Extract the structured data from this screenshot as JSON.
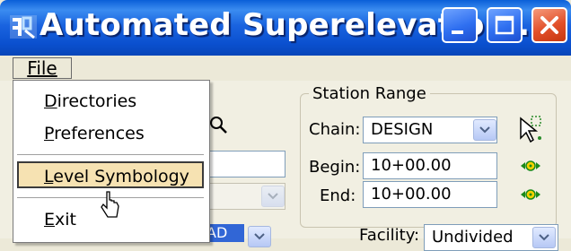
{
  "window": {
    "title": "Automated Superelevation..."
  },
  "menubar": {
    "file_label": "File"
  },
  "file_menu": {
    "items": [
      {
        "label": "Directories",
        "mnemonic": "D"
      },
      {
        "label": "Preferences",
        "mnemonic": "P"
      },
      {
        "label": "Level Symbology",
        "mnemonic": "L",
        "highlighted": true
      },
      {
        "label": "Exit",
        "mnemonic": "E"
      }
    ]
  },
  "station_range": {
    "title": "Station Range",
    "chain_label": "Chain:",
    "chain_value": "DESIGN",
    "begin_label": "Begin:",
    "begin_value": "10+00.00",
    "end_label": "End:",
    "end_value": "10+00.00"
  },
  "lower": {
    "facility_label": "Facility:",
    "facility_value": "Undivided",
    "left_partial": "AD"
  },
  "colors": {
    "accent": "#0a4fce",
    "highlight": "#f6e2b2",
    "close": "#e2502a"
  },
  "icons": [
    "app-icon",
    "minimize-icon",
    "maximize-icon",
    "close-icon",
    "search-icon",
    "pick-element-icon",
    "locate-begin-icon",
    "locate-end-icon",
    "chevron-down-icon",
    "mouse-cursor-icon"
  ]
}
